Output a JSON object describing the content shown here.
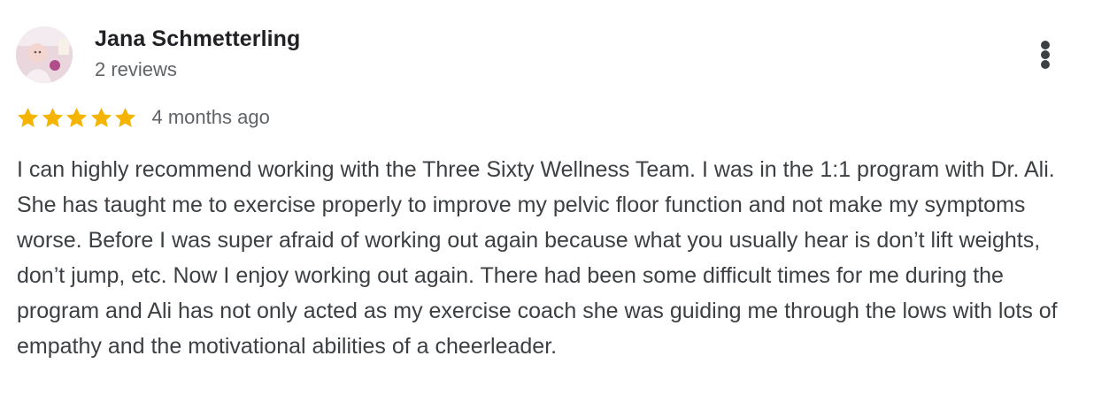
{
  "reviewer": {
    "name": "Jana Schmetterling",
    "review_count": "2 reviews"
  },
  "rating": {
    "stars": 5,
    "max_stars": 5,
    "star_color": "#f4b400",
    "date": "4 months ago"
  },
  "review_text": "I can highly recommend working with the Three Sixty Wellness Team. I was in the 1:1 program with Dr. Ali. She has taught me to exercise properly to improve my pelvic floor function and not make my symptoms worse. Before I was super afraid of working out again because what you usually hear is don’t lift weights, don’t jump, etc. Now I enjoy working out again. There had been some difficult times for me during the program and Ali has not only acted as my exercise coach she was guiding me through the lows with lots of empathy and the motivational abilities of a cheerleader.",
  "icons": {
    "avatar": "reviewer-avatar-photo",
    "more": "more-vert-icon",
    "star": "star-icon"
  },
  "colors": {
    "name": "#202124",
    "secondary_text": "#5f6368",
    "body_text": "#3c4043"
  }
}
